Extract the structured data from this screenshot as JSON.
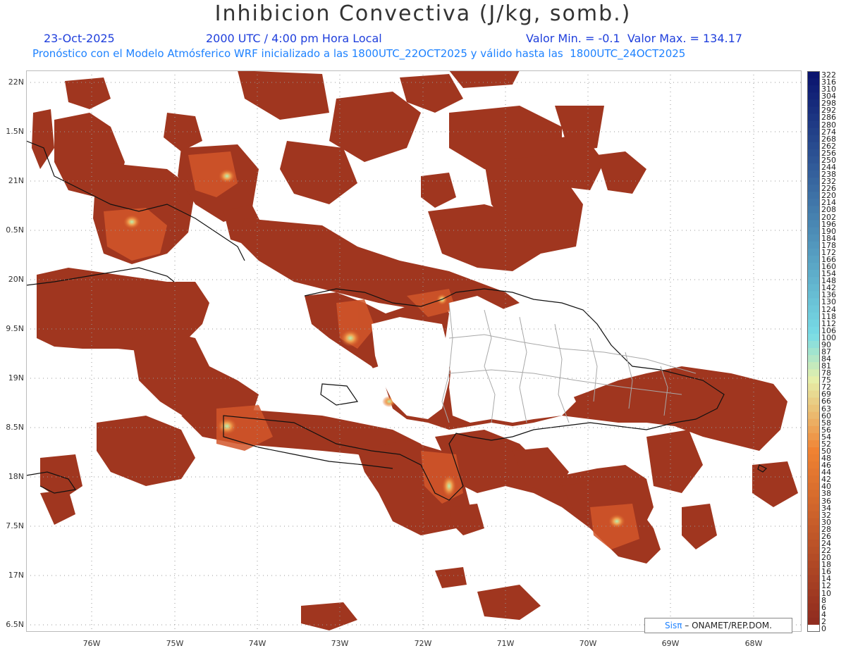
{
  "header": {
    "title": "Inhibicion Convectiva (J/kg, somb.)",
    "date": "23-Oct-2025",
    "time": "2000 UTC / 4:00 pm Hora Local",
    "range": "Valor Min. = -0.1  Valor Max. = 134.17",
    "subtitle": "Pronóstico con el Modelo Atmósferico WRF inicializado a las 1800UTC_22OCT2025 y válido hasta las  1800UTC_24OCT2025"
  },
  "map": {
    "latitude_labels": [
      "22N",
      "1.5N",
      "21N",
      "0.5N",
      "20N",
      "9.5N",
      "19N",
      "8.5N",
      "18N",
      "7.5N",
      "17N",
      "6.5N"
    ],
    "longitude_labels": [
      "76W",
      "75W",
      "74W",
      "73W",
      "72W",
      "71W",
      "70W",
      "69W",
      "68W"
    ]
  },
  "colorbar": {
    "labels": [
      "322",
      "316",
      "310",
      "304",
      "298",
      "292",
      "286",
      "280",
      "274",
      "268",
      "262",
      "256",
      "250",
      "244",
      "238",
      "232",
      "226",
      "220",
      "214",
      "208",
      "202",
      "196",
      "190",
      "184",
      "178",
      "172",
      "166",
      "160",
      "154",
      "148",
      "142",
      "136",
      "130",
      "124",
      "118",
      "112",
      "106",
      "100",
      "90",
      "87",
      "84",
      "81",
      "78",
      "75",
      "72",
      "69",
      "66",
      "63",
      "60",
      "58",
      "56",
      "54",
      "52",
      "50",
      "48",
      "46",
      "44",
      "42",
      "40",
      "38",
      "36",
      "34",
      "32",
      "30",
      "28",
      "26",
      "24",
      "22",
      "20",
      "18",
      "16",
      "14",
      "12",
      "10",
      "8",
      "6",
      "4",
      "2",
      "0"
    ]
  },
  "credit": {
    "brand": "Sisπ",
    "org": " – ONAMET/REP.DOM."
  }
}
